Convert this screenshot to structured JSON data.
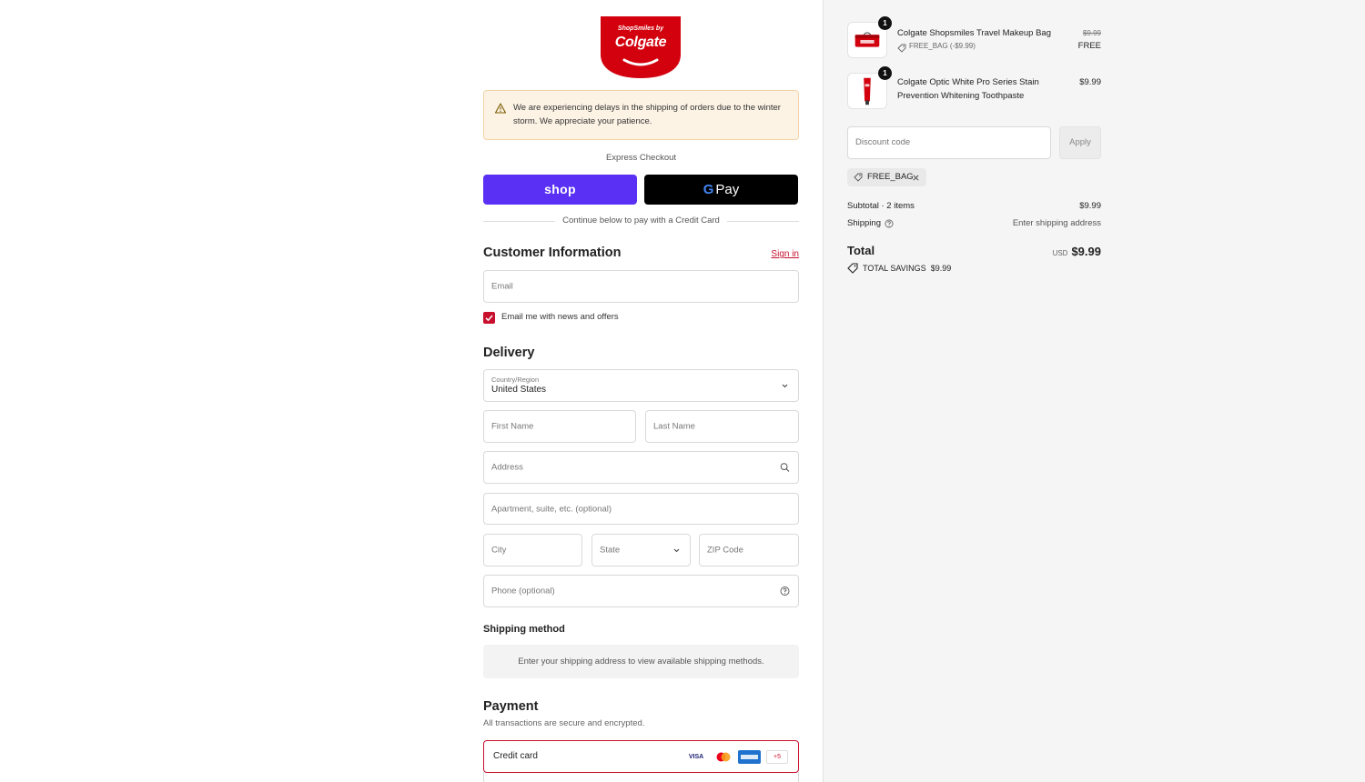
{
  "brand": {
    "logo_top": "ShopSmiles by",
    "logo_main": "Colgate",
    "accent": "#c8102e"
  },
  "alert": {
    "text": "We are experiencing delays in the shipping of orders due to the winter storm. We appreciate your patience."
  },
  "express": {
    "title": "Express Checkout",
    "shop_label": "shop",
    "gpay_g": "G",
    "gpay_label": "Pay",
    "divider": "Continue below to pay with a Credit Card"
  },
  "customer": {
    "title": "Customer Information",
    "signin": "Sign in",
    "email_placeholder": "Email",
    "newsletter_label": "Email me with news and offers",
    "newsletter_checked": true
  },
  "delivery": {
    "title": "Delivery",
    "country_label": "Country/Region",
    "country_value": "United States",
    "first_name": "First Name",
    "last_name": "Last Name",
    "address": "Address",
    "apartment": "Apartment, suite, etc. (optional)",
    "city": "City",
    "state": "State",
    "zip": "ZIP Code",
    "phone": "Phone (optional)"
  },
  "shipping_method": {
    "title": "Shipping method",
    "info": "Enter your shipping address to view available shipping methods."
  },
  "payment": {
    "title": "Payment",
    "subtitle": "All transactions are secure and encrypted.",
    "method": "Credit card",
    "cards": [
      "VISA",
      "MC",
      "AMEX"
    ],
    "more": "+5"
  },
  "cart": {
    "items": [
      {
        "qty": "1",
        "name": "Colgate Shopsmiles Travel Makeup Bag",
        "code": "FREE_BAG (-$9.99)",
        "original_price": "$9.99",
        "price": "FREE"
      },
      {
        "qty": "1",
        "name_line1": "Colgate Optic White Pro Series Stain",
        "name_line2": "Prevention Whitening Toothpaste",
        "price": "$9.99"
      }
    ],
    "discount_placeholder": "Discount code",
    "apply_label": "Apply",
    "applied_code": "FREE_BAG",
    "subtotal_label": "Subtotal · 2 items",
    "subtotal_value": "$9.99",
    "shipping_label": "Shipping",
    "shipping_value": "Enter shipping address",
    "total_label": "Total",
    "total_currency": "USD",
    "total_value": "$9.99",
    "savings_label": "TOTAL SAVINGS",
    "savings_value": "$9.99"
  }
}
